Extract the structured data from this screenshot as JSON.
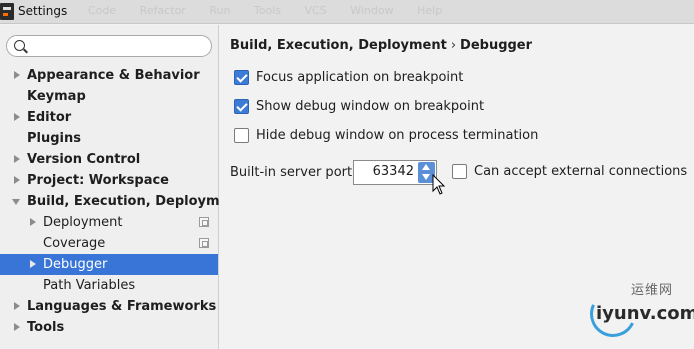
{
  "window": {
    "title": "Settings",
    "ghost_menu": [
      "Code",
      "Refactor",
      "Run",
      "Tools",
      "VCS",
      "Window",
      "Help"
    ]
  },
  "sidebar": {
    "search": {
      "value": "",
      "placeholder": ""
    },
    "items": [
      {
        "label": "Appearance & Behavior",
        "arrow": "right",
        "bold": true
      },
      {
        "label": "Keymap",
        "arrow": "none",
        "bold": true
      },
      {
        "label": "Editor",
        "arrow": "right",
        "bold": true
      },
      {
        "label": "Plugins",
        "arrow": "none",
        "bold": true
      },
      {
        "label": "Version Control",
        "arrow": "right",
        "bold": true
      },
      {
        "label": "Project: Workspace",
        "arrow": "right",
        "bold": true
      },
      {
        "label": "Build, Execution, Deployment",
        "arrow": "down",
        "bold": true
      },
      {
        "label": "Deployment",
        "arrow": "right",
        "bold": false,
        "project_icon": true
      },
      {
        "label": "Coverage",
        "arrow": "none",
        "bold": false,
        "project_icon": true
      },
      {
        "label": "Debugger",
        "arrow": "right",
        "bold": false,
        "selected": true
      },
      {
        "label": "Path Variables",
        "arrow": "none",
        "bold": false
      },
      {
        "label": "Languages & Frameworks",
        "arrow": "right",
        "bold": true
      },
      {
        "label": "Tools",
        "arrow": "right",
        "bold": true
      }
    ]
  },
  "main": {
    "breadcrumb": {
      "parent": "Build, Execution, Deployment",
      "separator": "›",
      "current": "Debugger"
    },
    "options": {
      "focus_app": {
        "label": "Focus application on breakpoint",
        "checked": true
      },
      "show_debug": {
        "label": "Show debug window on breakpoint",
        "checked": true
      },
      "hide_debug": {
        "label": "Hide debug window on process termination",
        "checked": false
      },
      "external": {
        "label": "Can accept external connections",
        "checked": false
      }
    },
    "port": {
      "label": "Built-in server port:",
      "value": "63342"
    }
  },
  "watermark": {
    "top_text": "运维网",
    "bottom_text": "iyunv.com"
  },
  "colors": {
    "selection": "#3875d7",
    "checkbox_checked": "#3d7cd6",
    "spinner": "#5b8fd6"
  }
}
